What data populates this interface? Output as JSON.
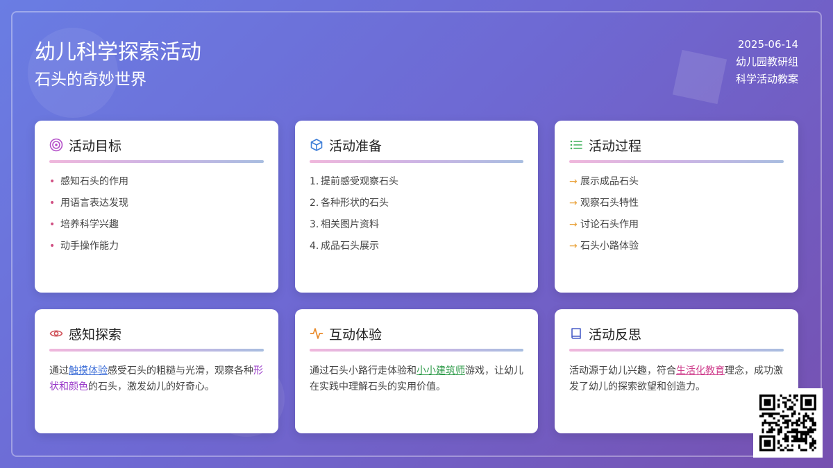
{
  "header": {
    "title": "幼儿科学探索活动",
    "subtitle": "石头的奇妙世界",
    "date": "2025-06-14",
    "org": "幼儿园教研组",
    "doc_type": "科学活动教案"
  },
  "colors": {
    "target_icon": "#b44fc9",
    "box_icon": "#3e7fd8",
    "list_icon": "#3fb15a",
    "eye_icon": "#d0535a",
    "activity_icon": "#e98a2a",
    "book_icon": "#4a5fc8"
  },
  "cards": {
    "goals": {
      "title": "活动目标",
      "icon": "target-icon",
      "items": [
        "感知石头的作用",
        "用语言表达发现",
        "培养科学兴趣",
        "动手操作能力"
      ]
    },
    "prep": {
      "title": "活动准备",
      "icon": "box-icon",
      "numbers": [
        "1.",
        "2.",
        "3.",
        "4."
      ],
      "items": [
        "提前感受观察石头",
        "各种形状的石头",
        "相关图片资料",
        "成品石头展示"
      ]
    },
    "process": {
      "title": "活动过程",
      "icon": "list-icon",
      "arrow": "→",
      "items": [
        "展示成品石头",
        "观察石头特性",
        "讨论石头作用",
        "石头小路体验"
      ]
    },
    "explore": {
      "title": "感知探索",
      "icon": "eye-icon",
      "p1": "通过",
      "hl1": "触摸体验",
      "p2": "感受石头的粗糙与光滑，观察各种",
      "hl2": "形状和颜色",
      "p3": "的石头，激发幼儿的好奇心。"
    },
    "interact": {
      "title": "互动体验",
      "icon": "activity-icon",
      "p1": "通过石头小路行走体验和",
      "hl1": "小小建筑师",
      "p2": "游戏，让幼儿在实践中理解石头的实用价值。"
    },
    "reflect": {
      "title": "活动反思",
      "icon": "book-icon",
      "p1": "活动源于幼儿兴趣，符合",
      "hl1": "生活化教育",
      "p2": "理念，成功激发了幼儿的探索欲望和创造力。"
    }
  },
  "qr": {
    "icon": "qr-code-icon"
  }
}
